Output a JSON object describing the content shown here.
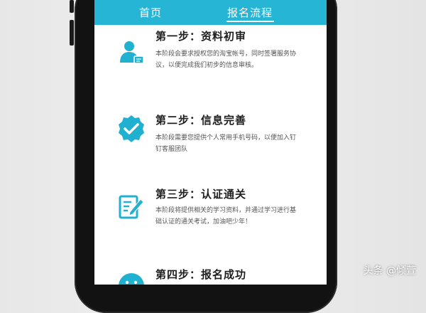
{
  "nav": {
    "tabs": [
      {
        "label": "首页",
        "active": false
      },
      {
        "label": "报名流程",
        "active": true
      }
    ],
    "bar_color": "#27b5d6"
  },
  "steps": [
    {
      "title": "第一步：资料初审",
      "description": "本阶段会要求授权您的淘宝帐号，同时签署服务协议，以便完成我们初步的信息审核。",
      "icon": "user-card-icon"
    },
    {
      "title": "第二步：信息完善",
      "description": "本阶段需要您提供个人常用手机号码，以便加入钉钉客服团队",
      "icon": "check-badge-icon"
    },
    {
      "title": "第三步：认证通关",
      "description": "本阶段将提供相关的学习资料，并通过学习进行基础认证的通关考试，加油吧少年！",
      "icon": "document-pen-icon"
    },
    {
      "title": "第四步：报名成功",
      "description": "",
      "icon": "smile-icon"
    }
  ],
  "accent_color": "#1fb1cf",
  "watermark": "头条 @倾萱"
}
